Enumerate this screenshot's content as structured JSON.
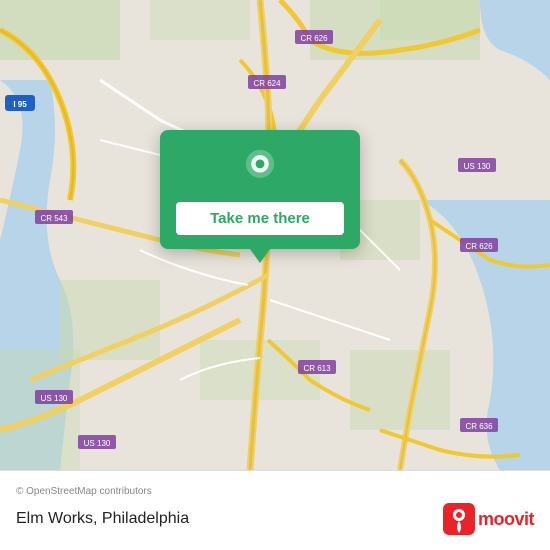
{
  "map": {
    "attribution": "© OpenStreetMap contributors",
    "backgroundColor": "#e8e0d8"
  },
  "card": {
    "button_label": "Take me there",
    "background_color": "#2da866"
  },
  "bottom_bar": {
    "copyright": "© OpenStreetMap contributors",
    "location_name": "Elm Works, Philadelphia"
  },
  "moovit": {
    "text": "moovit"
  },
  "roads": {
    "color_major": "#f5d98c",
    "color_minor": "#ffffff",
    "color_highway": "#e8c84a"
  }
}
